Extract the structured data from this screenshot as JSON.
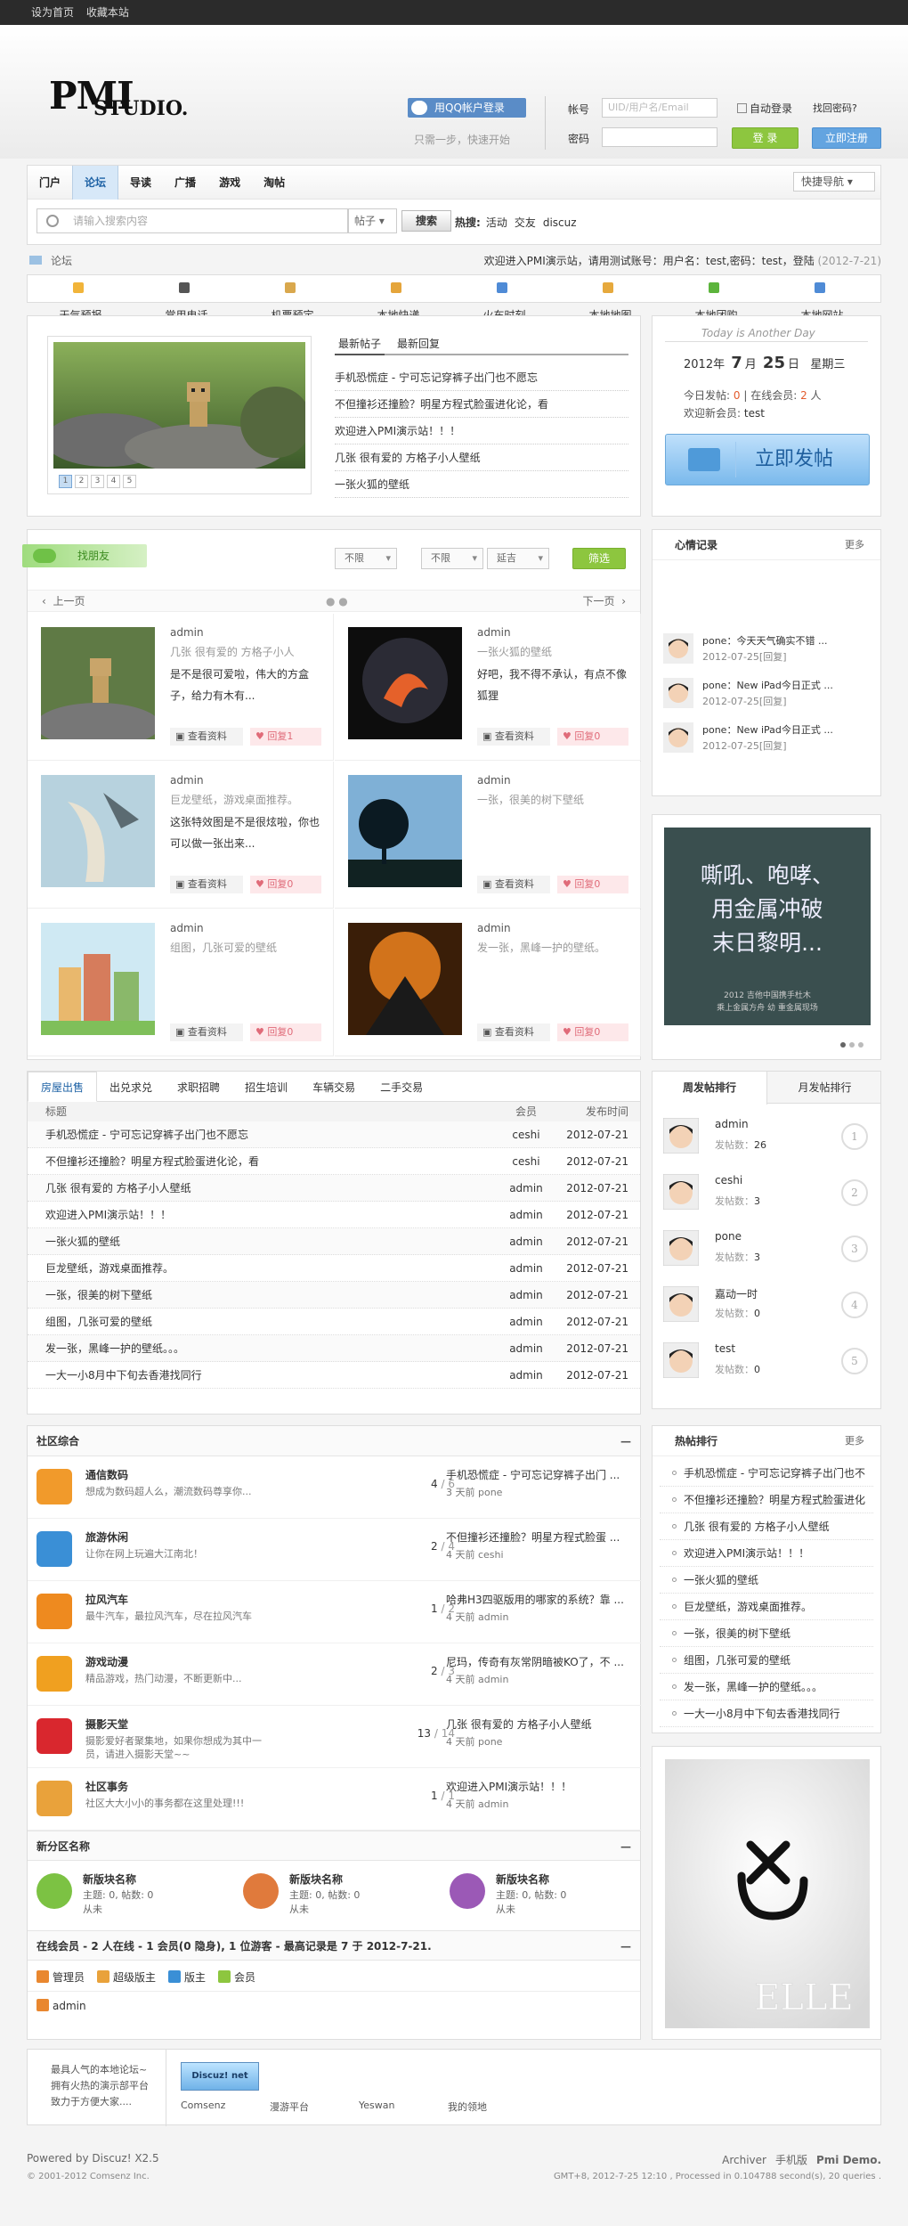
{
  "topbar": {
    "home": "设为首页",
    "fav": "收藏本站"
  },
  "header": {
    "logo_main": "PMI",
    "logo_sub": "STUDIO.",
    "qq_login": "用QQ帐户登录",
    "qq_sub": "只需一步，快速开始",
    "account_label": "帐号",
    "account_placeholder": "UID/用户名/Email",
    "password_label": "密码",
    "auto_login": "自动登录",
    "forgot": "找回密码?",
    "login": "登 录",
    "register": "立即注册"
  },
  "nav": {
    "items": [
      "门户",
      "论坛",
      "导读",
      "广播",
      "游戏",
      "淘帖"
    ],
    "active": "论坛",
    "quicknav": "快捷导航",
    "search_placeholder": "请输入搜索内容",
    "search_type": "帖子",
    "search_btn": "搜索",
    "hot_label": "热搜:",
    "hot": [
      "活动",
      "交友",
      "discuz"
    ]
  },
  "crumb": {
    "current": "论坛",
    "welcome": "欢迎进入PMI演示站，请用测试账号：用户名：test,密码：test，登陆",
    "date": "(2012-7-21)"
  },
  "links": [
    {
      "label": "天气预报",
      "color": "#f1b43a"
    },
    {
      "label": "常用电话",
      "color": "#555555"
    },
    {
      "label": "机票预定",
      "color": "#d9a84d"
    },
    {
      "label": "本地快递",
      "color": "#e5a53b"
    },
    {
      "label": "火车时刻",
      "color": "#4f8bd6"
    },
    {
      "label": "本地地图",
      "color": "#e6a93d"
    },
    {
      "label": "本地团购",
      "color": "#5cb43c"
    },
    {
      "label": "本地网站",
      "color": "#4f8bd6"
    }
  ],
  "feature": {
    "tabs": [
      "最新帖子",
      "最新回复"
    ],
    "active": "最新帖子",
    "pages": [
      "1",
      "2",
      "3",
      "4",
      "5"
    ],
    "posts": [
      "手机恐慌症 - 宁可忘记穿裤子出门也不愿忘",
      "不但撞衫还撞脸？明星方程式脸蛋进化论，看",
      "欢迎进入PMI演示站！！！",
      "几张 很有爱的 方格子小人壁纸",
      "一张火狐的壁纸"
    ]
  },
  "side1": {
    "today": "Today is Another Day",
    "year": "2012年",
    "month": "7",
    "month_unit": "月",
    "day": "25",
    "day_unit": "日",
    "weekday": "星期三",
    "today_posts_label": "今日发帖:",
    "today_posts": "0",
    "online_label": "在线会员:",
    "online": "2",
    "online_unit": "人",
    "new_member_label": "欢迎新会员:",
    "new_member": "test",
    "post_btn": "立即发帖"
  },
  "friends": {
    "badge": "找朋友",
    "selects": [
      "不限",
      "不限",
      "延吉"
    ],
    "filter": "筛选",
    "prev": "上一页",
    "next": "下一页",
    "card_profile": "查看资料",
    "card_reply": "回复",
    "items": [
      {
        "name": "admin",
        "sign": "几张 很有爱的 方格子小人",
        "text": "是不是很可爱啦，伟大的方盒子，给力有木有...",
        "reply": "1"
      },
      {
        "name": "admin",
        "sign": "一张火狐的壁纸",
        "text": "好吧，我不得不承认，有点不像狐狸",
        "reply": "0"
      },
      {
        "name": "admin",
        "sign": "巨龙壁纸，游戏桌面推荐。",
        "text": "这张特效图是不是很炫啦，你也可以做一张出来...",
        "reply": "0"
      },
      {
        "name": "admin",
        "sign": "一张，很美的树下壁纸",
        "text": "",
        "reply": "0"
      },
      {
        "name": "admin",
        "sign": "组图，几张可爱的壁纸",
        "text": "",
        "reply": "0"
      },
      {
        "name": "admin",
        "sign": "发一张，黑峰一护的壁纸。",
        "text": "",
        "reply": "0"
      }
    ]
  },
  "mood": {
    "title": "心情记录",
    "more": "更多",
    "items": [
      {
        "text": "pone：今天天气确实不错 ...",
        "date": "2012-07-25[回复]"
      },
      {
        "text": "pone：New iPad今日正式 ...",
        "date": "2012-07-25[回复]"
      },
      {
        "text": "pone：New iPad今日正式 ...",
        "date": "2012-07-25[回复]"
      }
    ]
  },
  "poster": {
    "line1": "嘶吼、咆哮、",
    "line2": "用金属冲破",
    "line3": "末日黎明...",
    "foot1": "2012  吉他中国携手杜木",
    "foot2": "乘上金属方舟  幼 重金属现场"
  },
  "classified": {
    "tabs": [
      "房屋出售",
      "出兑求兑",
      "求职招聘",
      "招生培训",
      "车辆交易",
      "二手交易"
    ],
    "active": "房屋出售",
    "head": {
      "title": "标题",
      "user": "会员",
      "date": "发布时间"
    },
    "rows": [
      {
        "t": "手机恐慌症 - 宁可忘记穿裤子出门也不愿忘",
        "u": "ceshi",
        "d": "2012-07-21"
      },
      {
        "t": "不但撞衫还撞脸？明星方程式脸蛋进化论，看",
        "u": "ceshi",
        "d": "2012-07-21"
      },
      {
        "t": "几张 很有爱的 方格子小人壁纸",
        "u": "admin",
        "d": "2012-07-21"
      },
      {
        "t": "欢迎进入PMI演示站！！！",
        "u": "admin",
        "d": "2012-07-21"
      },
      {
        "t": "一张火狐的壁纸",
        "u": "admin",
        "d": "2012-07-21"
      },
      {
        "t": "巨龙壁纸，游戏桌面推荐。",
        "u": "admin",
        "d": "2012-07-21"
      },
      {
        "t": "一张，很美的树下壁纸",
        "u": "admin",
        "d": "2012-07-21"
      },
      {
        "t": "组图，几张可爱的壁纸",
        "u": "admin",
        "d": "2012-07-21"
      },
      {
        "t": "发一张，黑峰一护的壁纸。。。",
        "u": "admin",
        "d": "2012-07-21"
      },
      {
        "t": "一大一小8月中下旬去香港找同行",
        "u": "admin",
        "d": "2012-07-21"
      }
    ]
  },
  "rank": {
    "tabs": [
      "周发帖排行",
      "月发帖排行"
    ],
    "active": "周发帖排行",
    "count_label": "发帖数：",
    "items": [
      {
        "name": "admin",
        "count": "26",
        "num": "1"
      },
      {
        "name": "ceshi",
        "count": "3",
        "num": "2"
      },
      {
        "name": "pone",
        "count": "3",
        "num": "3"
      },
      {
        "name": "嘉动一时",
        "count": "0",
        "num": "4"
      },
      {
        "name": "test",
        "count": "0",
        "num": "5"
      }
    ]
  },
  "forum": {
    "title": "社区综合",
    "collapse": "—",
    "items": [
      {
        "name": "通信数码",
        "desc": "想成为数码超人么，潮流数码尊享你...",
        "today": "4",
        "total": "6",
        "last": "手机恐慌症 - 宁可忘记穿裤子出门 ...",
        "when": "3 天前 pone",
        "color": "#f19a2b"
      },
      {
        "name": "旅游休闲",
        "desc": "让你在网上玩遍大江南北！",
        "today": "2",
        "total": "4",
        "last": "不但撞衫还撞脸？明星方程式脸蛋 ...",
        "when": "4 天前 ceshi",
        "color": "#3a8fd6"
      },
      {
        "name": "拉风汽车",
        "desc": "最牛汽车，最拉风汽车，尽在拉风汽车",
        "today": "1",
        "total": "2",
        "last": "哈弗H3四驱版用的哪家的系统？靠 ...",
        "when": "4 天前 admin",
        "color": "#ee8a1f"
      },
      {
        "name": "游戏动漫",
        "desc": "精品游戏，热门动漫，不断更新中...",
        "today": "2",
        "total": "3",
        "last": "尼玛，传奇有灰常阴暗被KO了，不 ...",
        "when": "4 天前 admin",
        "color": "#f0a020"
      },
      {
        "name": "摄影天堂",
        "desc": "摄影爱好者聚集地，如果你想成为其中一员，请进入摄影天堂~~",
        "today": "13",
        "total": "14",
        "last": "几张 很有爱的 方格子小人壁纸",
        "when": "4 天前 pone",
        "color": "#d9272e"
      },
      {
        "name": "社区事务",
        "desc": "社区大大小小的事务都在这里处理!!!",
        "today": "1",
        "total": "1",
        "last": "欢迎进入PMI演示站！！！",
        "when": "4 天前 admin",
        "color": "#e9a23b"
      }
    ],
    "sub_title": "新分区名称",
    "sub_items": [
      {
        "name": "新版块名称",
        "stat": "主题: 0, 帖数: 0",
        "last": "从未",
        "color": "#7cc243"
      },
      {
        "name": "新版块名称",
        "stat": "主题: 0, 帖数: 0",
        "last": "从未",
        "color": "#e07a3c"
      },
      {
        "name": "新版块名称",
        "stat": "主题: 0, 帖数: 0",
        "last": "从未",
        "color": "#9b59b6"
      }
    ],
    "online_title": "在线会员 - 2 人在线 - 1 会员(0 隐身), 1 位游客 - 最高记录是 7 于 2012-7-21.",
    "legend": [
      {
        "label": "管理员",
        "color": "#e9872f"
      },
      {
        "label": "超级版主",
        "color": "#e9a23b"
      },
      {
        "label": "版主",
        "color": "#3a8fd6"
      },
      {
        "label": "会员",
        "color": "#8dc63f"
      }
    ],
    "online_user": "admin"
  },
  "hot2": {
    "title": "热帖排行",
    "more": "更多",
    "items": [
      "手机恐慌症 - 宁可忘记穿裤子出门也不",
      "不但撞衫还撞脸？明星方程式脸蛋进化",
      "几张 很有爱的 方格子小人壁纸",
      "欢迎进入PMI演示站！！！",
      "一张火狐的壁纸",
      "巨龙壁纸，游戏桌面推荐。",
      "一张，很美的树下壁纸",
      "组图，几张可爱的壁纸",
      "发一张，黑峰一护的壁纸。。。",
      "一大一小8月中下旬去香港找同行"
    ]
  },
  "ellie": {
    "brand": "ELLE"
  },
  "flinks": {
    "text1": "最具人气的本地论坛~",
    "text2": "拥有火热的演示部平台",
    "text3": "致力于方便大家....",
    "logo": "Discuz! net",
    "items": [
      "Comsenz",
      "漫游平台",
      "Yeswan",
      "我的领地"
    ]
  },
  "footer": {
    "powered": "Powered by Discuz! X2.5",
    "copy": "© 2001-2012 Comsenz Inc.",
    "links": [
      "Archiver",
      "手机版",
      "Pmi Demo."
    ],
    "gmt": "GMT+8, 2012-7-25 12:10 , Processed in 0.104788 second(s), 20 queries ."
  }
}
